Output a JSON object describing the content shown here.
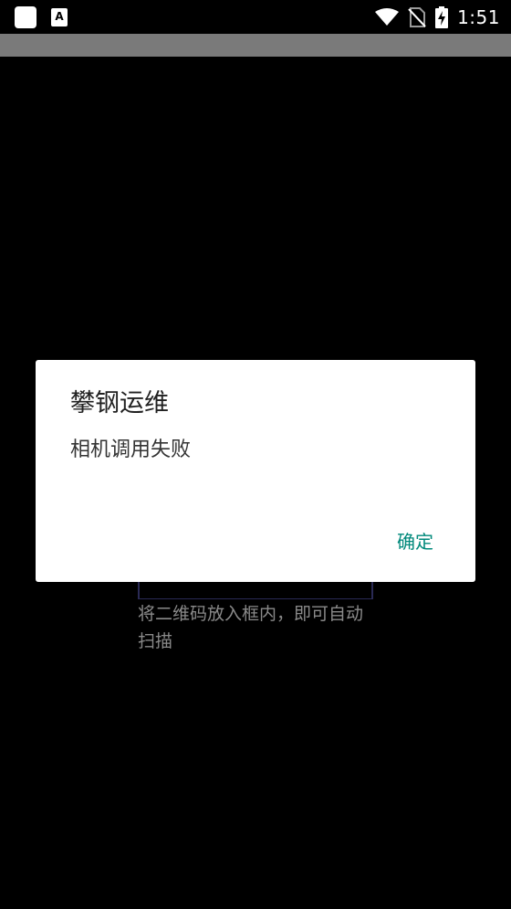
{
  "status_bar": {
    "time": "1:51",
    "icons": [
      "app-icon",
      "a-notification-icon",
      "wifi-icon",
      "no-sim-icon",
      "battery-charging-icon"
    ]
  },
  "scanner": {
    "hint": "将二维码放入框内，即可自动扫描"
  },
  "dialog": {
    "title": "攀钢运维",
    "message": "相机调用失败",
    "ok_label": "确定"
  },
  "colors": {
    "accent": "#00897b",
    "background": "#000000",
    "app_bar": "#7a7a7a"
  }
}
